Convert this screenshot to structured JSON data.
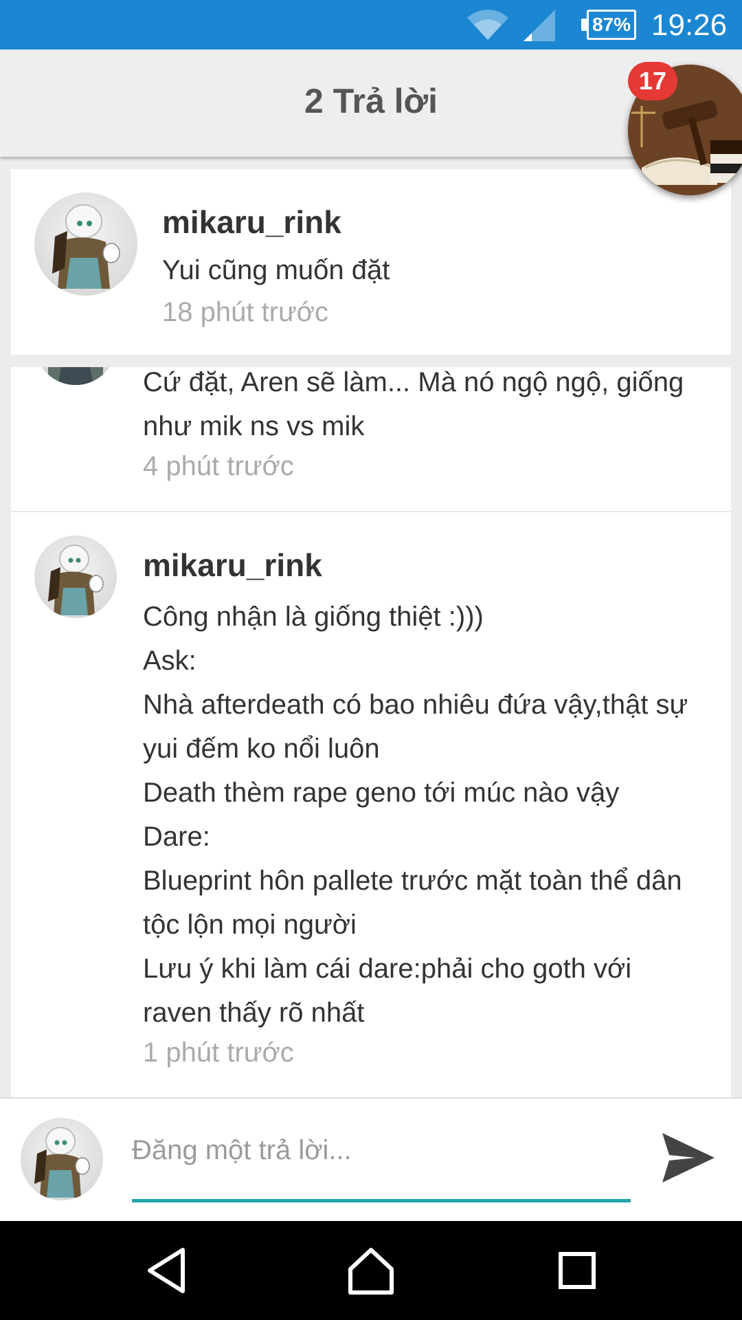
{
  "status_bar": {
    "battery": "87%",
    "time": "19:26"
  },
  "header": {
    "title": "2 Trả lời"
  },
  "bubble": {
    "badge": "17"
  },
  "quoted_post": {
    "username": "mikaru_rink",
    "text": "Yui cũng muốn đặt",
    "time": "18 phút trước"
  },
  "comments": [
    {
      "lines": [
        "Cứ đặt, Aren sẽ làm... Mà nó ngộ ngộ, giống",
        "như mik ns vs mik"
      ],
      "time": "4 phút trước"
    },
    {
      "username": "mikaru_rink",
      "lines": [
        "Công nhận là giống thiệt :)))",
        "Ask:",
        "Nhà afterdeath có bao nhiêu đứa vậy,thật sự",
        "yui đếm ko nổi luôn",
        "Death thèm rape geno tới múc nào vậy",
        "Dare:",
        "Blueprint hôn pallete trước mặt toàn thể dân",
        "tộc lộn mọi người",
        "Lưu ý khi làm cái dare:phải cho goth với",
        "raven thấy rõ nhất"
      ],
      "time": "1 phút trước"
    }
  ],
  "reply": {
    "placeholder": "Đăng một trả lời..."
  },
  "colors": {
    "status_bar": "#1b87d2",
    "accent_underline": "#22a5a8",
    "badge": "#e53935"
  }
}
